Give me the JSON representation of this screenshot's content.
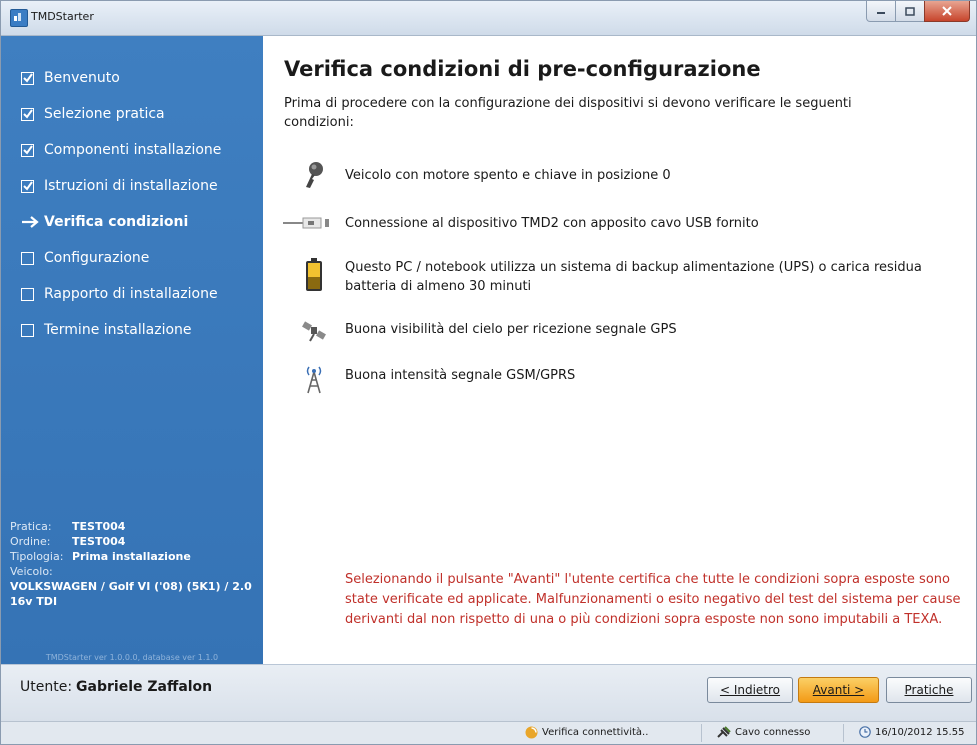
{
  "window": {
    "title": "TMDStarter"
  },
  "sidebar": {
    "steps": [
      {
        "label": "Benvenuto",
        "state": "done"
      },
      {
        "label": "Selezione pratica",
        "state": "done"
      },
      {
        "label": "Componenti installazione",
        "state": "done"
      },
      {
        "label": "Istruzioni di installazione",
        "state": "done"
      },
      {
        "label": "Verifica condizioni",
        "state": "current"
      },
      {
        "label": "Configurazione",
        "state": "todo"
      },
      {
        "label": "Rapporto di installazione",
        "state": "todo"
      },
      {
        "label": "Termine installazione",
        "state": "todo"
      }
    ],
    "info": {
      "pratica_label": "Pratica:",
      "pratica": "TEST004",
      "ordine_label": "Ordine:",
      "ordine": "TEST004",
      "tipologia_label": "Tipologia:",
      "tipologia": "Prima installazione",
      "veicolo_label": "Veicolo:",
      "veicolo": "VOLKSWAGEN / Golf VI ('08) (5K1) / 2.0 16v TDI"
    },
    "version": "TMDStarter ver 1.0.0.0, database ver 1.1.0"
  },
  "main": {
    "title": "Verifica condizioni di pre-configurazione",
    "intro": "Prima di procedere con la configurazione dei dispositivi si devono verificare le seguenti condizioni:",
    "conditions": [
      {
        "icon": "key-icon",
        "text": "Veicolo con motore spento e chiave in posizione 0"
      },
      {
        "icon": "usb-cable-icon",
        "text": "Connessione al dispositivo TMD2 con apposito cavo USB fornito"
      },
      {
        "icon": "battery-icon",
        "text": "Questo PC / notebook utilizza un sistema di backup alimentazione (UPS) o carica residua batteria di almeno 30 minuti"
      },
      {
        "icon": "satellite-icon",
        "text": "Buona visibilità del cielo per ricezione segnale GPS"
      },
      {
        "icon": "antenna-icon",
        "text": "Buona intensità segnale GSM/GPRS"
      }
    ],
    "warning": "Selezionando il pulsante \"Avanti\" l'utente certifica che tutte le condizioni sopra esposte sono state verificate ed applicate. Malfunzionamenti o esito negativo del test del sistema per cause derivanti dal non rispetto di una o più condizioni sopra esposte non sono imputabili a TEXA."
  },
  "footer": {
    "user_label": "Utente:",
    "user_name": "Gabriele Zaffalon",
    "back_label": "< Indietro",
    "next_label": "Avanti >",
    "pratiche_label": "Pratiche"
  },
  "statusbar": {
    "connectivity": "Verifica connettività..",
    "cable": "Cavo connesso",
    "datetime": "16/10/2012 15.55"
  },
  "colors": {
    "sidebar": "#3a78bb",
    "warning": "#c0302a",
    "accent_button": "#f5a623"
  }
}
